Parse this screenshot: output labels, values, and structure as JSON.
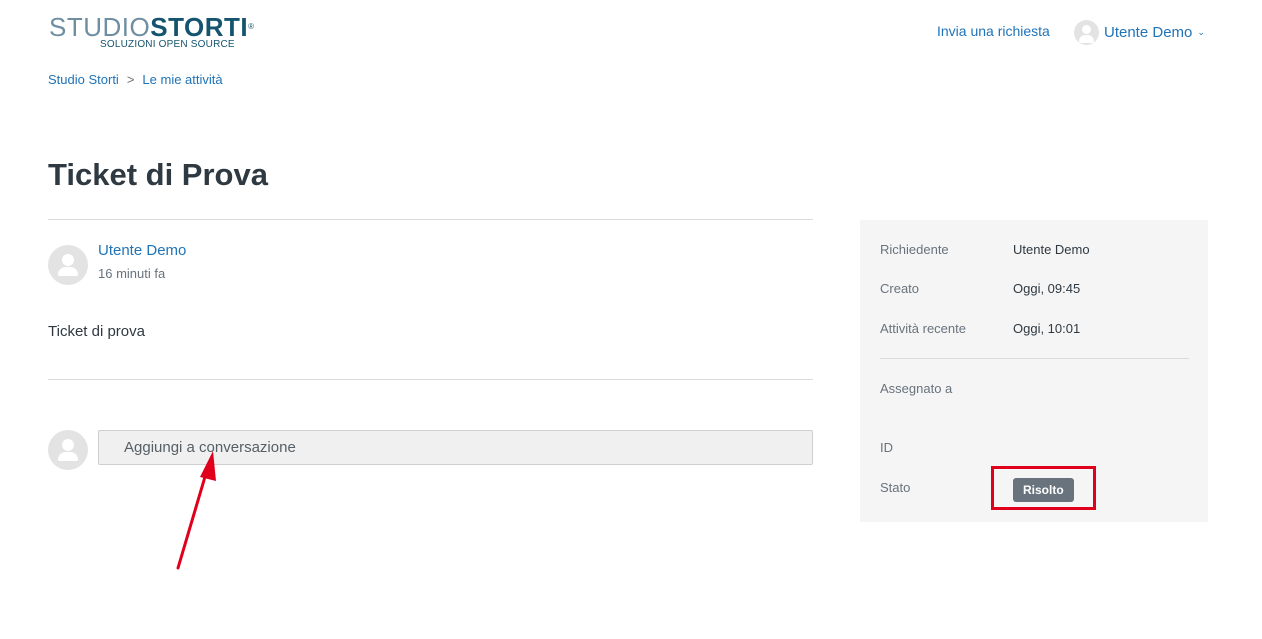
{
  "header": {
    "logo": {
      "part1": "STUDIO",
      "part2": "STORTI",
      "reg": "®",
      "tagline": "SOLUZIONI OPEN SOURCE"
    },
    "submit_request": "Invia una richiesta",
    "user_name": "Utente Demo",
    "user_chevron": "⌄"
  },
  "breadcrumb": {
    "items": [
      "Studio Storti",
      "Le mie attività"
    ],
    "separator": ">"
  },
  "page": {
    "title": "Ticket di Prova"
  },
  "comment": {
    "author": "Utente Demo",
    "time": "16 minuti fa",
    "body": "Ticket di prova"
  },
  "reply": {
    "placeholder": "Aggiungi a conversazione"
  },
  "sidebar": {
    "requester_label": "Richiedente",
    "requester_value": "Utente Demo",
    "created_label": "Creato",
    "created_value": "Oggi, 09:45",
    "activity_label": "Attività recente",
    "activity_value": "Oggi, 10:01",
    "assignee_label": "Assegnato a",
    "id_label": "ID",
    "status_label": "Stato",
    "status_value": "Risolto"
  },
  "colors": {
    "link": "#1f73b7",
    "annotation": "#e0001b",
    "badge": "#68737d"
  }
}
